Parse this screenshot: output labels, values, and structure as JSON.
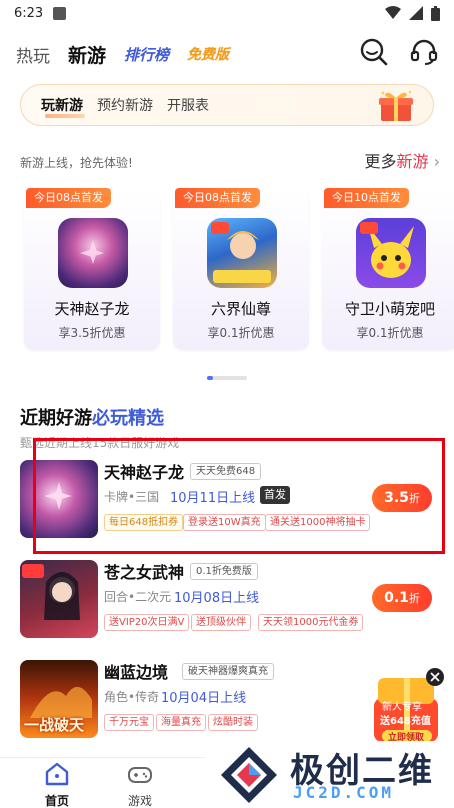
{
  "status_bar": {
    "time": "6:23"
  },
  "top_nav": {
    "tabs": [
      {
        "label": "热玩"
      },
      {
        "label": "新游"
      },
      {
        "label": "排行榜"
      },
      {
        "label": "免费版"
      }
    ]
  },
  "sub_tabs": {
    "tabs": [
      {
        "label": "玩新游"
      },
      {
        "label": "预约新游"
      },
      {
        "label": "开服表"
      }
    ]
  },
  "new_games": {
    "hint": "新游上线，抢先体验!",
    "more_prefix": "更多",
    "more_highlight": "新游",
    "cards": [
      {
        "badge": "今日08点首发",
        "name": "天神赵子龙",
        "discount": "享3.5折优惠"
      },
      {
        "badge": "今日08点首发",
        "name": "六界仙尊",
        "discount": "享0.1折优惠"
      },
      {
        "badge": "今日10点首发",
        "name": "守卫小萌宠吧",
        "discount": "享0.1折优惠"
      }
    ]
  },
  "recent": {
    "title_prefix": "近期好游",
    "title_highlight": "必玩精选",
    "subtitle": "甄选近期上线15款日服好游戏"
  },
  "rows": [
    {
      "name": "天神赵子龙",
      "tag": "天天免费648",
      "meta": "卡牌•三国",
      "date": "10月11日上线",
      "first": "首发",
      "chips": [
        "每日648抵扣券",
        "登录送10W真充",
        "通关送1000神将抽卡"
      ],
      "price": "3.5",
      "price_unit": "折"
    },
    {
      "name": "苍之女武神",
      "tag": "0.1折免费版",
      "meta": "回合•二次元",
      "date": "10月08日上线",
      "chips": [
        "送VIP20次日满V",
        "送顶级伙伴",
        "天天领1000元代金券"
      ],
      "price": "0.1",
      "price_unit": "折"
    },
    {
      "name": "幽蓝边境",
      "tag": "破天神器爆爽真充",
      "meta": "角色•传奇",
      "date": "10月04日上线",
      "chips": [
        "千万元宝",
        "海量真充",
        "炫酷时装"
      ],
      "thumb_text": "一战破天"
    }
  ],
  "promo": {
    "line1": "新人专享",
    "line2": "送648充值",
    "button": "立即领取"
  },
  "bottom_nav": [
    {
      "label": "首页"
    },
    {
      "label": "游戏"
    }
  ],
  "watermark": {
    "text": "极创二维",
    "url": "JC2D.COM"
  },
  "colors": {
    "accent": "#3f5bd6",
    "hot": "#e8364e",
    "orange": "#ff6a28",
    "highlight_box": "#e60012"
  }
}
